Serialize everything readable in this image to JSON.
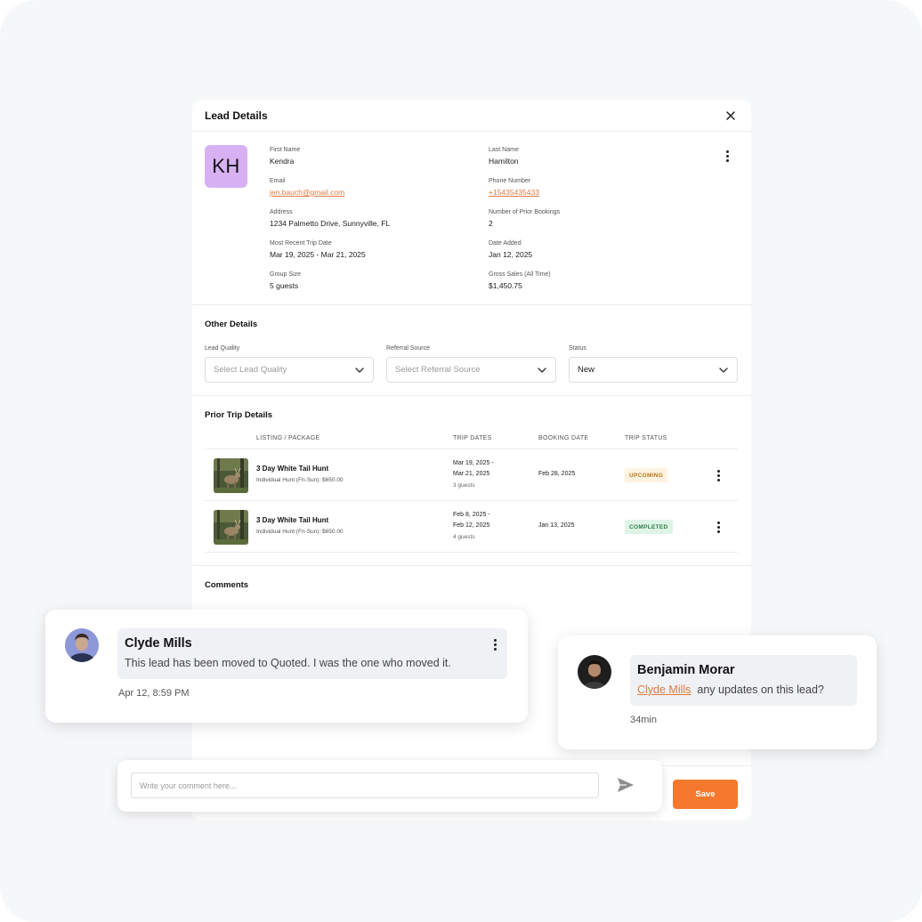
{
  "panel": {
    "title": "Lead Details"
  },
  "lead": {
    "initials": "KH",
    "first_name_label": "First Name",
    "first_name": "Kendra",
    "last_name_label": "Last Name",
    "last_name": "Hamilton",
    "email_label": "Email",
    "email": "jen.bauch@gmail.com",
    "phone_label": "Phone Number",
    "phone": "+15435435433",
    "address_label": "Address",
    "address": "1234 Palmetto Drive, Sunnyville, FL",
    "prior_bookings_label": "Number of Prior Bookings",
    "prior_bookings": "2",
    "recent_trip_label": "Most Recent Trip Date",
    "recent_trip": "Mar 19, 2025 - Mar 21, 2025",
    "date_added_label": "Date Added",
    "date_added": "Jan 12, 2025",
    "group_size_label": "Group Size",
    "group_size": "5 guests",
    "gross_sales_label": "Gross Sales (All Time)",
    "gross_sales": "$1,450.75"
  },
  "other_details": {
    "title": "Other Details",
    "lead_quality_label": "Lead Quality",
    "lead_quality_placeholder": "Select Lead Quality",
    "referral_label": "Referral Source",
    "referral_placeholder": "Select Referral Source",
    "status_label": "Status",
    "status_value": "New"
  },
  "prior_trips": {
    "title": "Prior Trip Details",
    "headers": [
      "LISTING / PACKAGE",
      "TRIP DATES",
      "BOOKING DATE",
      "TRIP STATUS"
    ],
    "rows": [
      {
        "name": "3 Day White Tail Hunt",
        "package": "Individual Hunt (Fri-Sun): $650.00",
        "date_start": "Mar 19, 2025 -",
        "date_end": "Mar 21, 2025",
        "guests": "3 guests",
        "booking_date": "Feb 28, 2025",
        "status": "UPCOMING"
      },
      {
        "name": "3 Day White Tail Hunt",
        "package": "Individual Hunt (Fri-Sun): $650.00",
        "date_start": "Feb 8, 2025 -",
        "date_end": "Feb 12, 2025",
        "guests": "4 guests",
        "booking_date": "Jan 13, 2025",
        "status": "COMPLETED"
      }
    ]
  },
  "comments": {
    "title": "Comments",
    "items": [
      {
        "author": "Clyde Mills",
        "text": "This lead has been moved to Quoted. I was the one who moved it.",
        "time": "Apr 12, 8:59 PM"
      },
      {
        "author": "Benjamin Morar",
        "mention": "Clyde Mills",
        "text": "any updates on this lead?",
        "time": "34min"
      }
    ],
    "input_placeholder": "Write your comment here..."
  },
  "actions": {
    "save_label": "Save"
  },
  "colors": {
    "accent": "#f5782d",
    "link": "#e07b43",
    "avatar_bg": "#d7b1f3",
    "upcoming_bg": "#fdf3e0",
    "completed_bg": "#dff4e7"
  },
  "icons": {
    "close": "close-icon",
    "more": "kebab-menu-icon",
    "chevron": "chevron-down-icon",
    "send": "send-icon"
  }
}
